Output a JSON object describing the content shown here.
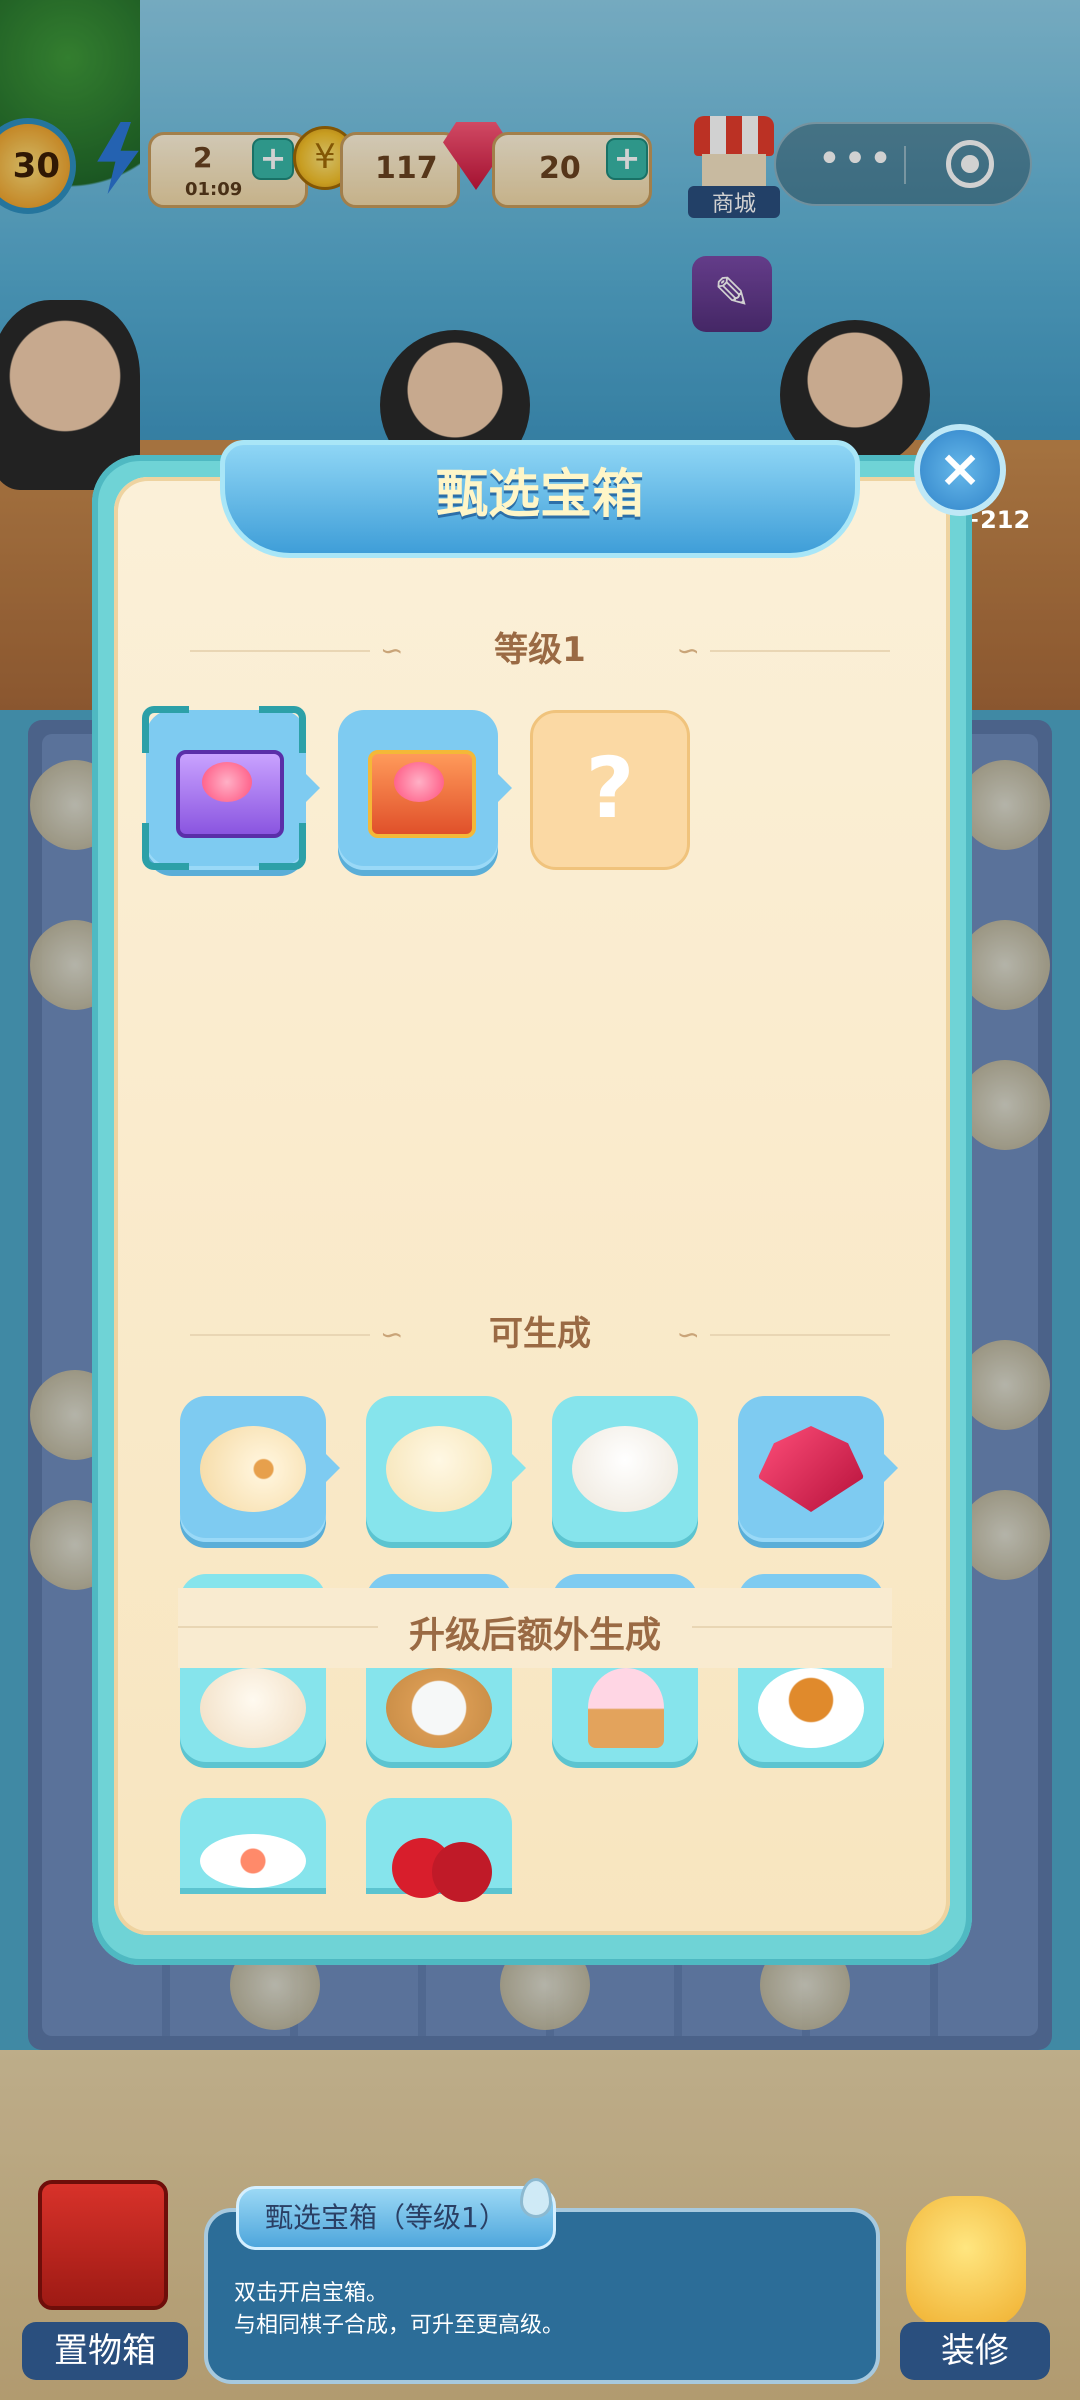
{
  "hud": {
    "level": "30",
    "energy": "2",
    "energy_timer": "01:09",
    "coins": "117",
    "gems": "20",
    "plus": "+",
    "shop_label": "商城",
    "score_popup": "+212"
  },
  "capsule": {
    "more": "•••"
  },
  "modal": {
    "title": "甄选宝箱",
    "close": "×",
    "level_section": "等级1",
    "unknown_mark": "?",
    "generate_section": "可生成",
    "upgrade_section": "升级后额外生成",
    "level_items": [
      "purple-treasure-chest",
      "gold-treasure-chest",
      "locked-unknown"
    ],
    "generate_items": [
      "swirl-roll",
      "sesame-bun",
      "steamed-bun",
      "ruby-gems"
    ],
    "upgrade_items": [
      "filled-bun",
      "tea-set",
      "ice-cream-cone",
      "tea-cup",
      "fruit-plate",
      "cherries"
    ]
  },
  "bottom": {
    "storage_label": "置物箱",
    "info_title": "甄选宝箱（等级1）",
    "info_line1": "双击开启宝箱。",
    "info_line2": "与相同棋子合成，可升至更高级。",
    "decorate_label": "装修"
  },
  "colors": {
    "modal_border": "#6fd3d6",
    "modal_bg": "#fbf0d8",
    "title_blue": "#3f9ed8",
    "tile_blue": "#7ecbf1",
    "tile_cyan": "#86e4ec",
    "section_text": "#9a6a44"
  }
}
